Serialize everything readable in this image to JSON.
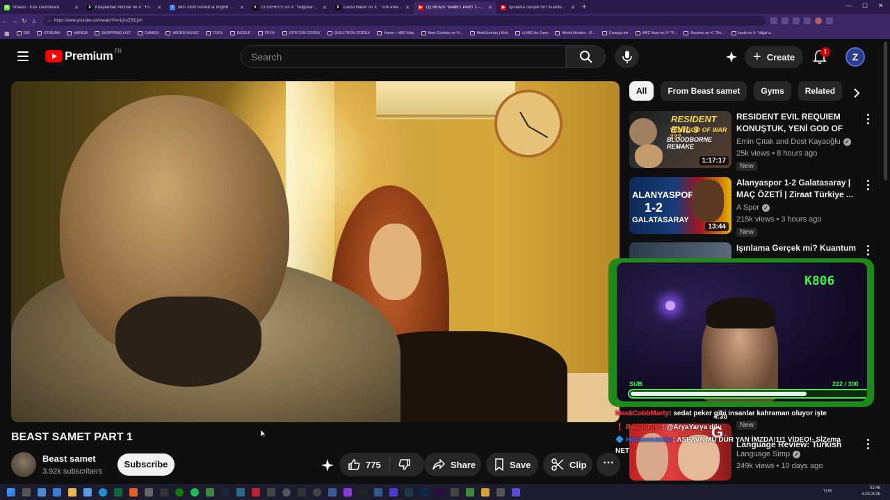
{
  "browser": {
    "tabs": [
      {
        "title": "Stream - Kick Dashboard",
        "icon": "kick-icon",
        "color": "#53fc18",
        "glyph": "K"
      },
      {
        "title": "Kitaplardan Alıntılar on X: \"Filozof...",
        "icon": "x-icon",
        "color": "#000000",
        "glyph": "X"
      },
      {
        "title": "IMG 2830 hosted at ImgBB — Img...",
        "icon": "imgbb-icon",
        "color": "#3b82f6",
        "glyph": "I"
      },
      {
        "title": "23 DERECE on X: \"Bağcılar'da döv...",
        "icon": "x-icon",
        "color": "#000000",
        "glyph": "X"
      },
      {
        "title": "GaGa Haber on X: \"Türk erkekleri...",
        "icon": "x-icon",
        "color": "#000000",
        "glyph": "X"
      },
      {
        "title": "(1) BEAST SAMET PART 1 - YouTube",
        "icon": "youtube-icon",
        "color": "#ff0000",
        "glyph": "▶"
      },
      {
        "title": "Işınlama Gerçek mi? Kuantum Ceva...",
        "icon": "youtube-icon",
        "color": "#ff0000",
        "glyph": "▶"
      }
    ],
    "active_tab": 5,
    "url": "https://www.youtube.com/watch?v=1jXoZt5Cjv0",
    "bookmarks": [
      "DIR",
      "STREAM",
      "MANGA",
      "SHOPPING LIST",
      "GAMES",
      "WEIRD MUSIC",
      "TOOL",
      "INCELE",
      "FFXIV",
      "EPSTEIN CODEX",
      "QUELTRON CODEX",
      "Home • HBO Max",
      "Mert Günhan ve Yi...",
      "MertGunhan | Kick",
      "LIVAD for Fans",
      "World Monitor - R...",
      "CreepyLink",
      "ARC Now on X: \"P...",
      "Rooster on X: \"Do...",
      "taoki on X: \"diğaf a..."
    ]
  },
  "header": {
    "logo_text": "Premium",
    "country": "TR",
    "search_placeholder": "Search",
    "create_label": "Create",
    "notifications": "1",
    "avatar_letter": "Z"
  },
  "video": {
    "title": "BEAST SAMET PART 1",
    "channel": "Beast samet",
    "subscribers": "3.92k subscribers",
    "subscribe_label": "Subscribe",
    "likes": "775",
    "share_label": "Share",
    "save_label": "Save",
    "clip_label": "Clip"
  },
  "chips": [
    "All",
    "From Beast samet",
    "Gyms",
    "Related"
  ],
  "recommendations": [
    {
      "title": "RESIDENT EVIL REQUIEM KONUŞTUK, YENİ GOD OF WA...",
      "channel": "Emin Çıtak and Dost Kayaoğlu",
      "meta": "25k views • 8 hours ago",
      "duration": "1:17:17",
      "badge": "New",
      "verified": true
    },
    {
      "title": "Alanyaspor 1-2 Galatasaray | MAÇ ÖZETİ | Ziraat Türkiye ...",
      "channel": "A Spor",
      "meta": "215k views • 3 hours ago",
      "duration": "13:44",
      "badge": "New",
      "verified": true
    },
    {
      "title": "Işınlama Gerçek mi? Kuantum",
      "channel": "",
      "meta": "",
      "duration": "",
      "badge": "",
      "verified": false
    },
    {
      "title": "Language Review: Turkish",
      "channel": "Language Simp",
      "meta": "249k views • 10 days ago",
      "duration": "4:30",
      "badge": "New",
      "verified": true
    }
  ],
  "thumb_texts": {
    "re_line1": "RESIDENT EVIL 9",
    "re_line2": "YENİ GOD OF WAR ???",
    "re_line3": "BLOODBORNE REMAKE",
    "spor_line1": "ALANYASPOR",
    "spor_line2": "1-2",
    "spor_line3": "GALATASARAY",
    "lang_letter": "G"
  },
  "overlay": {
    "tag": "K806",
    "sub_label": "SUB",
    "count": "222 / 300",
    "progress": 0.74
  },
  "chat": [
    {
      "user": "MaskCobbMarty",
      "text": ": sedat peker gibi insanlar kahraman oluyor işte",
      "color": "#ff3b3b"
    },
    {
      "user": "RaddoBiye",
      "text": ": @AryaYarya döv",
      "color": "#ff3b3b"
    },
    {
      "user": "Horaswsataka",
      "text": ": ASPAVA MÜ DÜR YAN İMZDA!1!1 VİDEO!- SİZema",
      "color": "#3b6cff"
    },
    {
      "user": "",
      "text": "NET",
      "color": "#ffffff"
    }
  ],
  "taskbar": {
    "lang": "TUR",
    "time": "02:46",
    "date": "4.03.2026"
  }
}
